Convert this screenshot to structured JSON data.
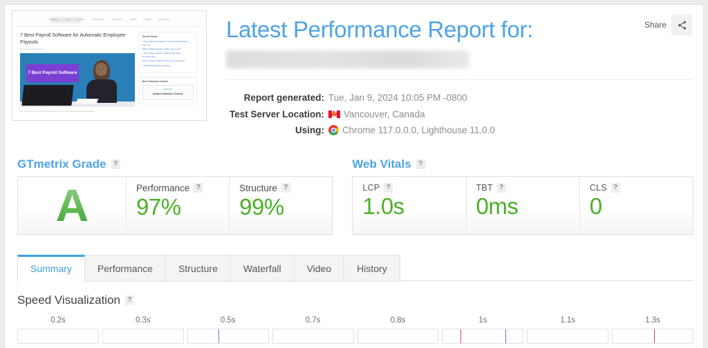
{
  "share": {
    "label": "Share",
    "icon": "share-icon"
  },
  "header": {
    "title": "Latest Performance Report for:",
    "url_redacted": "",
    "meta": [
      {
        "key": "Report generated:",
        "value": "Tue, Jan 9, 2024 10:05 PM -0800",
        "icon": ""
      },
      {
        "key": "Test Server Location:",
        "value": "Vancouver, Canada",
        "icon": "canada-flag-icon"
      },
      {
        "key": "Using:",
        "value": "Chrome 117.0.0.0, Lighthouse 11.0.0",
        "icon": "chrome-icon"
      }
    ]
  },
  "thumbnail": {
    "nav_items": [
      "Technology",
      "Apps",
      "Business",
      "How To Guides",
      "Tips & Tricks",
      "Reviews",
      "Gadgets",
      "Web Hosting"
    ],
    "article_title": "7 Best Payroll Software for Automatic Employee Payouts",
    "article_meta": "October 28, 2023 by Admin",
    "hero_text": "7 Best Payroll Software",
    "body_text": "Are you searching for the best Payroll software for employee payouts? This article has",
    "sidebar_heading": "Recent Posts",
    "sidebar_links": [
      "7 Best Payroll Software for Automatic Employee Payouts",
      "What is ERP software? What does it do?",
      "7 Best Unity Software 2023 for 3D Game Development",
      "What is Unity Software? How it can be used?",
      "7 Best 3D Modeling Software"
    ],
    "ad_heading": "Best Grammar Checker",
    "ad_brand": "grammarly",
    "ad_title": "Instant Grammar Checker"
  },
  "grade_panel": {
    "heading": "GTmetrix Grade",
    "help": "?",
    "grade": "A",
    "metrics": [
      {
        "label": "Performance",
        "value": "97%",
        "help": "?"
      },
      {
        "label": "Structure",
        "value": "99%",
        "help": "?"
      }
    ]
  },
  "vitals_panel": {
    "heading": "Web Vitals",
    "help": "?",
    "metrics": [
      {
        "label": "LCP",
        "value": "1.0s",
        "help": "?"
      },
      {
        "label": "TBT",
        "value": "0ms",
        "help": "?"
      },
      {
        "label": "CLS",
        "value": "0",
        "help": "?"
      }
    ]
  },
  "tabs": [
    {
      "label": "Summary",
      "active": true
    },
    {
      "label": "Performance",
      "active": false
    },
    {
      "label": "Structure",
      "active": false
    },
    {
      "label": "Waterfall",
      "active": false
    },
    {
      "label": "Video",
      "active": false
    },
    {
      "label": "History",
      "active": false
    }
  ],
  "speed_visualization": {
    "heading": "Speed Visualization",
    "help": "?",
    "ticks": [
      "0.2s",
      "0.3s",
      "0.5s",
      "0.7s",
      "0.8s",
      "1s",
      "1.1s",
      "1.3s"
    ]
  },
  "colors": {
    "accent_blue": "#4ea3e3",
    "score_green": "#4caf28",
    "grade_green_top": "#93d18c",
    "grade_green_bottom": "#3fa13a",
    "tab_active_blue": "#38a0e0",
    "text_dark": "#3a3a3a",
    "text_muted": "#8d8d8d"
  }
}
